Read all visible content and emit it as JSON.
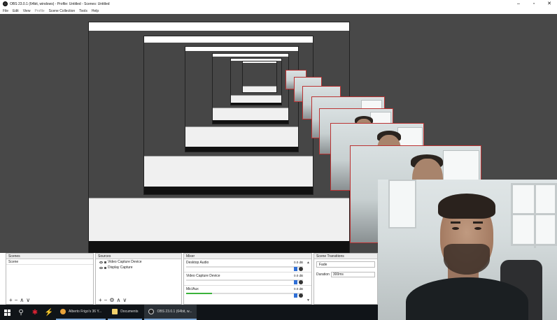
{
  "window": {
    "title": "OBS 23.0.1 (64bit, windows) - Profile: Untitled - Scenes: Untitled",
    "controls": [
      "–",
      "▫",
      "✕"
    ]
  },
  "menu": [
    "File",
    "Edit",
    "View",
    "Profile",
    "Scene Collection",
    "Tools",
    "Help"
  ],
  "docks": {
    "scenes": {
      "header": "Scenes",
      "items": [
        "Scene"
      ]
    },
    "sources": {
      "header": "Sources",
      "items": [
        "Video Capture Device",
        "Display Capture"
      ]
    },
    "mixer": {
      "header": "Mixer",
      "channels": [
        {
          "name": "Desktop Audio",
          "db": "0.0 dB",
          "level": 0.0
        },
        {
          "name": "Video Capture Device",
          "db": "0.0 dB",
          "level": 0.0
        },
        {
          "name": "Mic/Aux",
          "db": "0.0 dB",
          "level": 0.22
        }
      ]
    },
    "transitions": {
      "header": "Scene Transitions",
      "selected": "Fade",
      "duration_label": "Duration",
      "duration_value": "300ms"
    }
  },
  "footer_icons": {
    "add": "+",
    "remove": "−",
    "up": "∧",
    "down": "∨",
    "gear": "⚙"
  },
  "taskbar": {
    "tasks": [
      {
        "label": "Alberto Frigo's 36 Y...",
        "color": "#e8a23a"
      },
      {
        "label": "Documents",
        "color": "#f2d16b"
      },
      {
        "label": "OBS 23.0.1 (64bit, w...",
        "color": "#cccccc"
      }
    ]
  }
}
